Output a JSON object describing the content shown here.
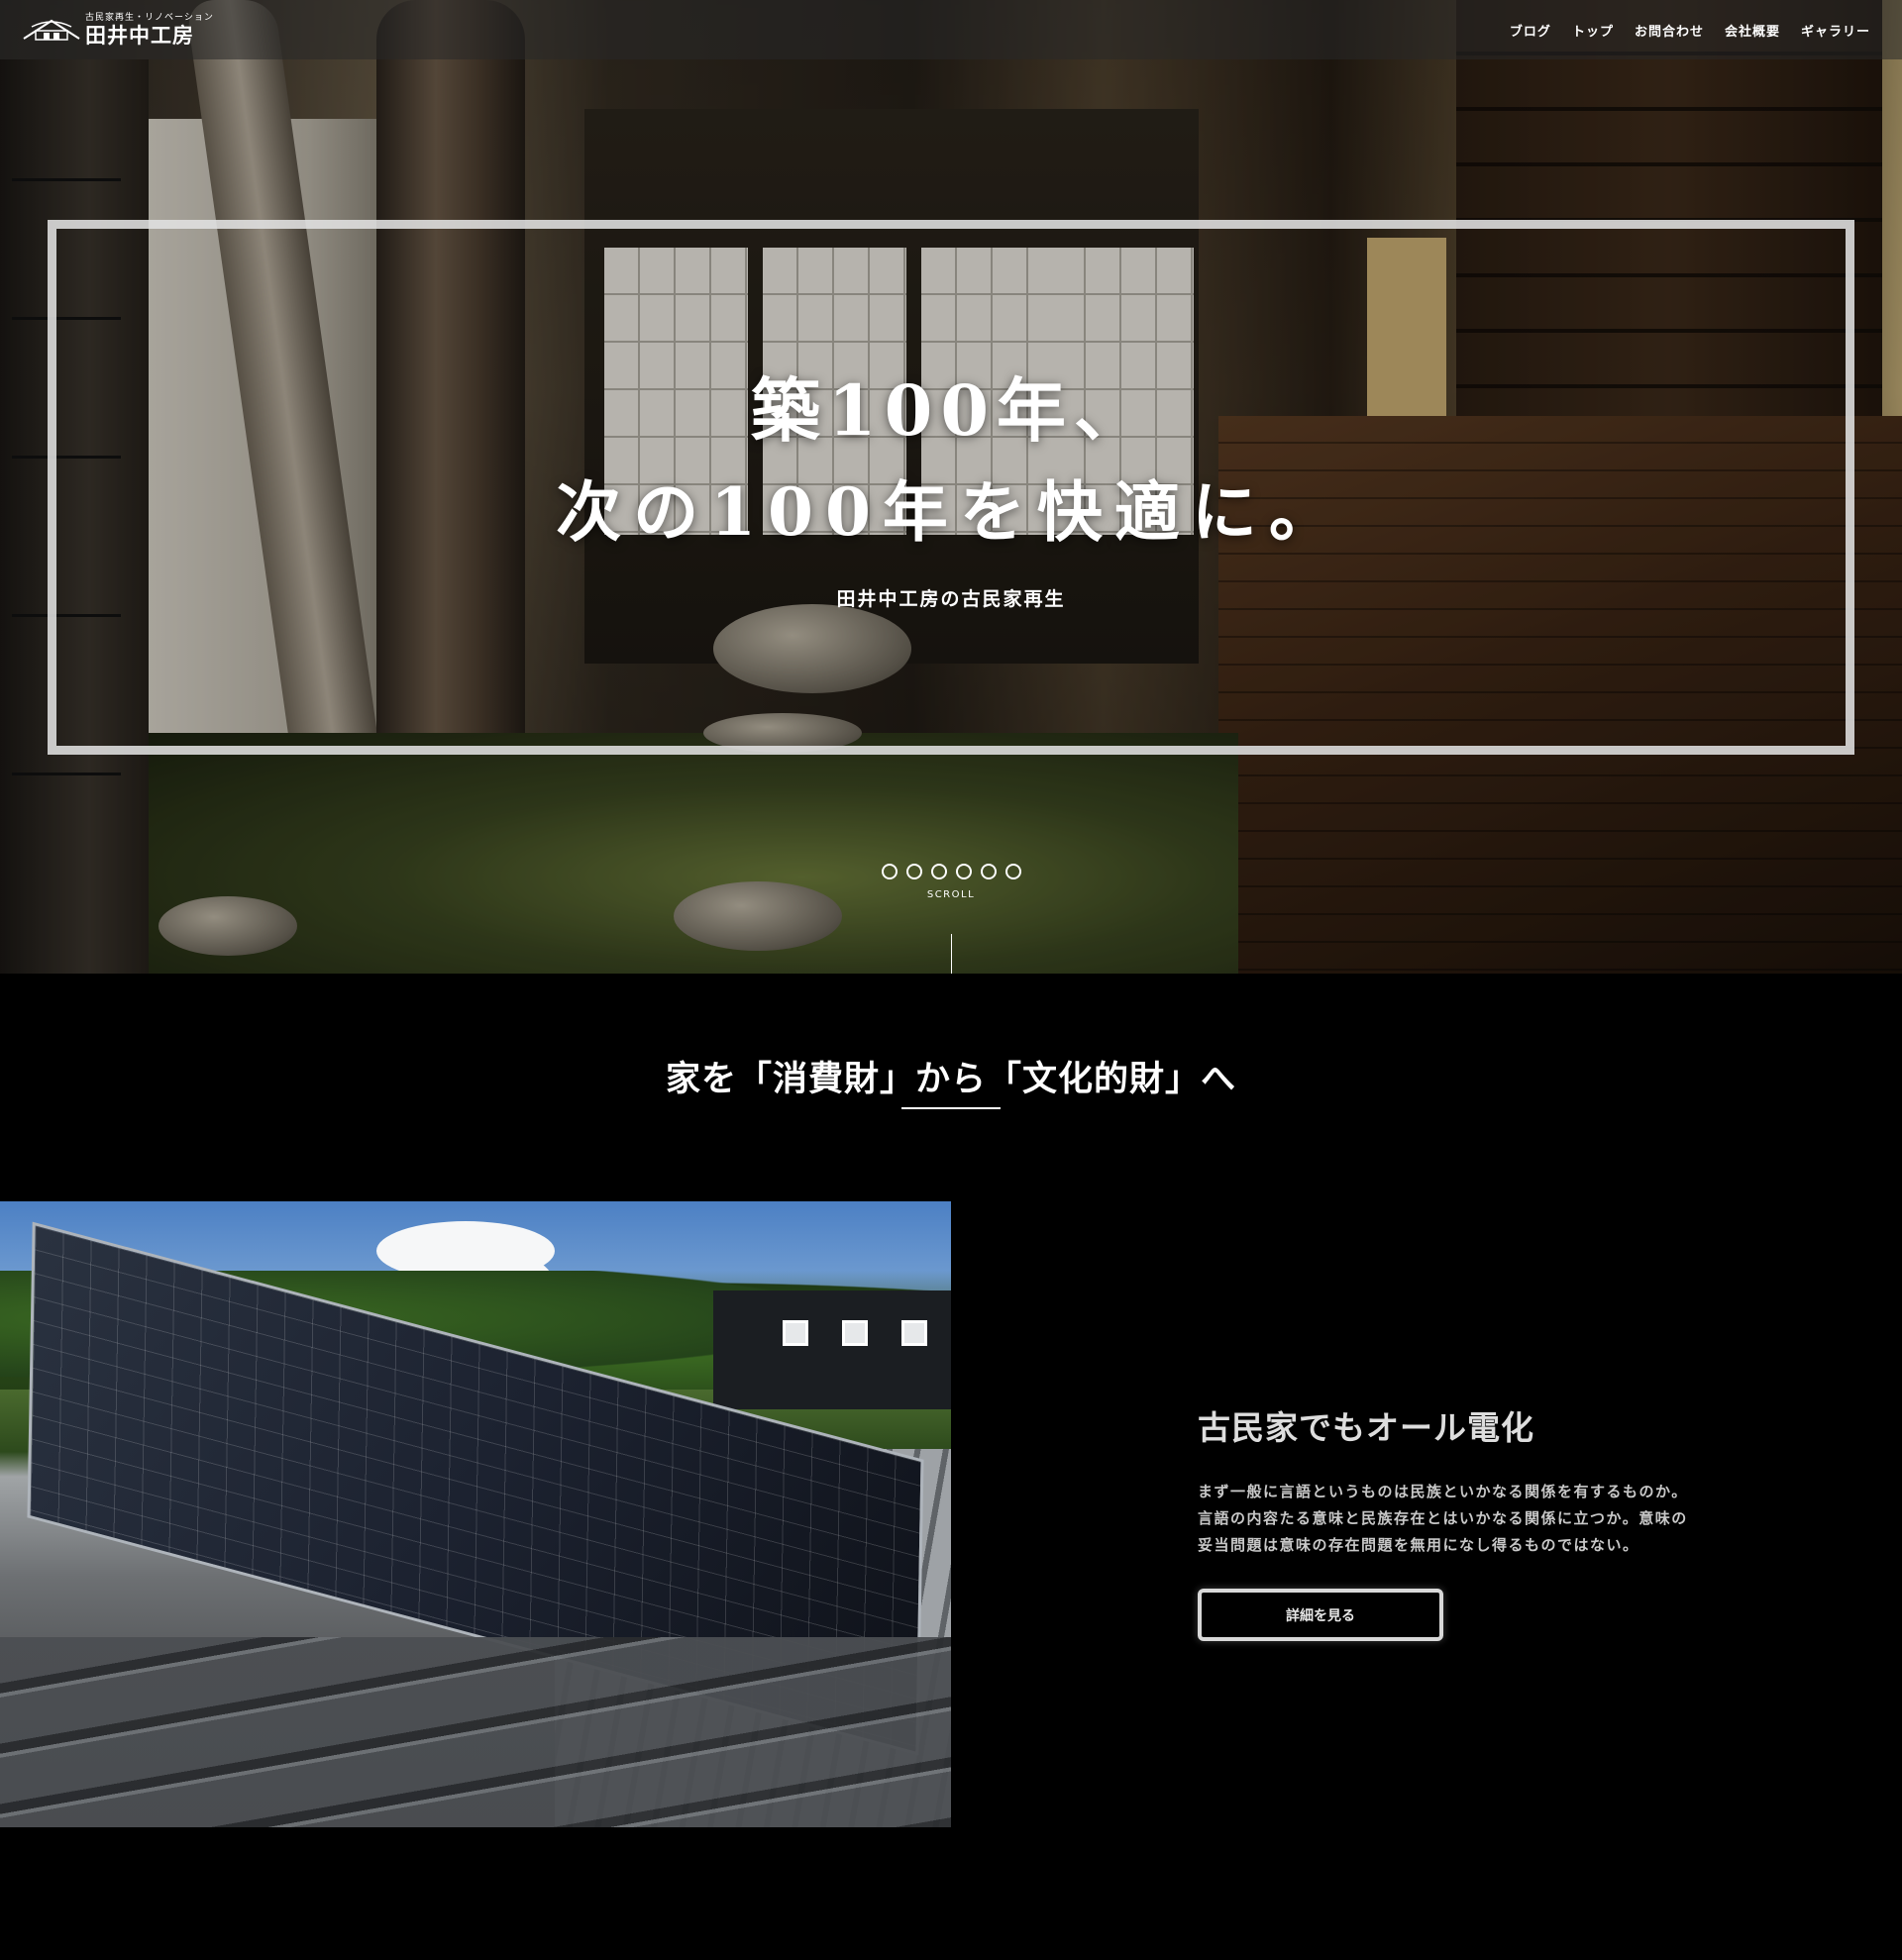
{
  "header": {
    "logo_subtitle": "古民家再生・リノベーション",
    "logo_name": "田井中工房",
    "nav": [
      {
        "label": "ブログ"
      },
      {
        "label": "トップ"
      },
      {
        "label": "お問合わせ"
      },
      {
        "label": "会社概要"
      },
      {
        "label": "ギャラリー"
      }
    ]
  },
  "hero": {
    "line1": "築100年、",
    "line2": "次の100年を快適に。",
    "tagline": "田井中工房の古民家再生",
    "slide_count": 6,
    "scroll_label": "SCROLL"
  },
  "section": {
    "title": "家を「消費財」から「文化的財」へ"
  },
  "feature": {
    "title": "古民家でもオール電化",
    "text": "まず一般に言語というものは民族といかなる関係を有するものか。言語の内容たる意味と民族存在とはいかなる関係に立つか。意味の妥当問題は意味の存在問題を無用になし得るものではない。",
    "button_label": "詳細を見る"
  }
}
